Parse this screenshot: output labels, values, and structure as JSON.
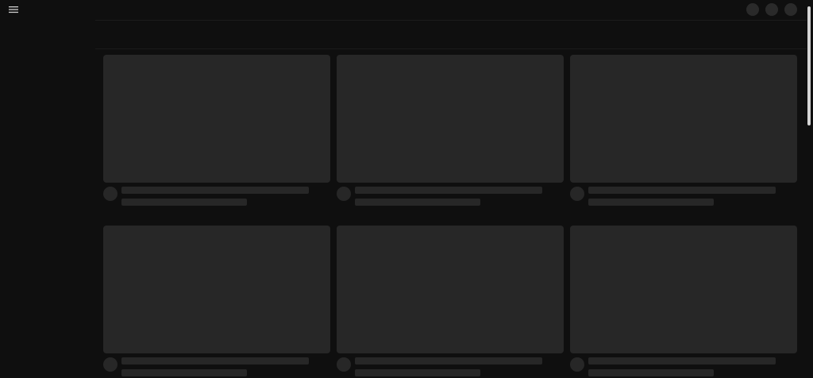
{
  "header": {
    "menu_icon": "hamburger-menu-icon",
    "actions": [
      {
        "icon": "placeholder-circle"
      },
      {
        "icon": "placeholder-circle"
      },
      {
        "icon": "placeholder-circle"
      }
    ]
  },
  "feed": {
    "cards": [
      {},
      {},
      {},
      {},
      {},
      {}
    ]
  },
  "colors": {
    "background": "#0f0f0f",
    "skeleton": "#272727",
    "scroll_thumb": "#d4d4d4",
    "icon": "#cfcfcf"
  }
}
